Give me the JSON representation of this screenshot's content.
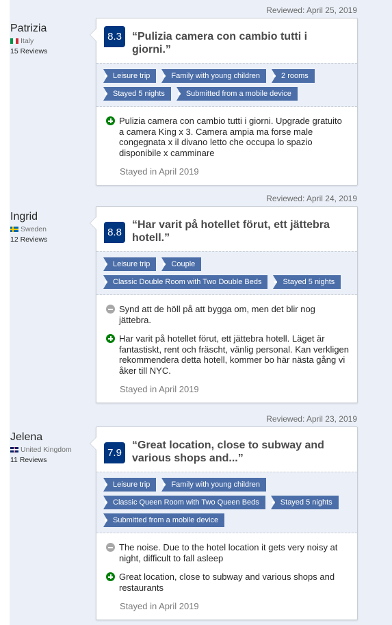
{
  "reviews": [
    {
      "reviewed_date": "Reviewed: April 25, 2019",
      "name": "Patrizia",
      "country": "Italy",
      "review_count": "15 Reviews",
      "score": "8.3",
      "title": "“Pulizia camera con cambio tutti i giorni.”",
      "tags": [
        "Leisure trip",
        "Family with young children",
        "2 rooms",
        "Stayed 5 nights",
        "Submitted from a mobile device"
      ],
      "negative": "",
      "positive": "Pulizia camera con cambio tutti i giorni. Upgrade gratuito a camera King x 3. Camera ampia ma forse male congegnata x il divano letto che occupa lo spazio disponibile x camminare",
      "stayed": "Stayed in April 2019"
    },
    {
      "reviewed_date": "Reviewed: April 24, 2019",
      "name": "Ingrid",
      "country": "Sweden",
      "review_count": "12 Reviews",
      "score": "8.8",
      "title": "“Har varit på hotellet förut, ett jättebra hotell.”",
      "tags": [
        "Leisure trip",
        "Couple",
        "Classic Double Room with Two Double Beds",
        "Stayed 5 nights"
      ],
      "negative": "Synd att de höll på att bygga om, men det blir nog jättebra.",
      "positive": "Har varit på hotellet förut, ett jättebra hotell. Läget är fantastiskt, rent och fräscht, vänlig personal. Kan verkligen rekommendera detta hotell, kommer bo här nästa gång vi åker till NYC.",
      "stayed": "Stayed in April 2019"
    },
    {
      "reviewed_date": "Reviewed: April 23, 2019",
      "name": "Jelena",
      "country": "United Kingdom",
      "review_count": "11 Reviews",
      "score": "7.9",
      "title": "“Great location, close to subway and various shops and...”",
      "tags": [
        "Leisure trip",
        "Family with young children",
        "Classic Queen Room with Two Queen Beds",
        "Stayed 5 nights",
        "Submitted from a mobile device"
      ],
      "negative": "The noise. Due to the hotel location it gets very noisy at night, difficult to fall asleep",
      "positive": "Great location, close to subway and various shops and restaurants",
      "stayed": "Stayed in April 2019"
    }
  ],
  "colors": {
    "score_bg": "#003580",
    "tag_bg": "#4b6ea8",
    "positive_icon": "#008009",
    "negative_icon": "#a8a8a8"
  }
}
